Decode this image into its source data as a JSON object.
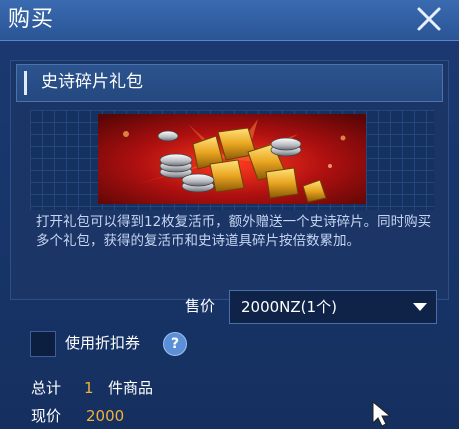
{
  "dialog": {
    "title": "购买",
    "close_icon": "close-icon"
  },
  "item": {
    "name": "史诗碎片礼包",
    "description": "打开礼包可以得到12枚复活币，额外赠送一个史诗碎片。同时购买多个礼包，获得的复活币和史诗道具碎片按倍数累加。"
  },
  "price": {
    "label": "售价",
    "selected": "2000NZ(1个)",
    "dropdown_icon": "chevron-down-icon"
  },
  "discount": {
    "label": "使用折扣券",
    "checked": false,
    "help_glyph": "?"
  },
  "summary": {
    "total_label": "总计",
    "total_count": "1",
    "total_unit": "件商品",
    "now_price_label": "现价",
    "now_price_value": "2000"
  },
  "colors": {
    "accent_value": "#f1b13a",
    "title_bar": "#2a5596",
    "background": "#18356a"
  }
}
